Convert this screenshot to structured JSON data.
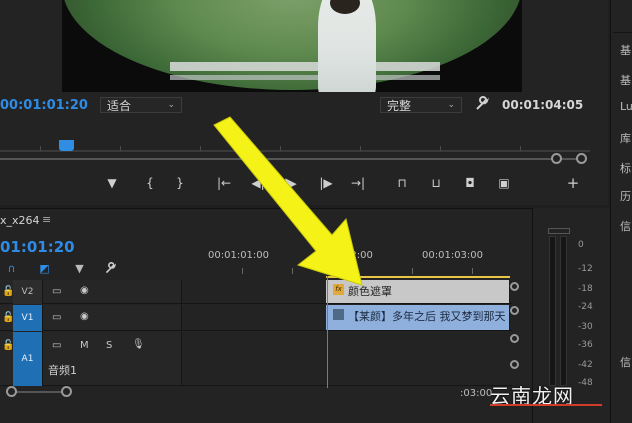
{
  "monitor": {
    "current_timecode": "00:01:01:20",
    "zoom_select": "适合",
    "quality_select": "完整",
    "duration_timecode": "00:01:04:05"
  },
  "controls": {
    "marker": "▼",
    "in": "{",
    "out": "}",
    "go_in": "|←",
    "step_back": "◀|",
    "play": "▶",
    "step_forward": "|▶",
    "go_out": "→|",
    "lift": "⊓",
    "extract": "⊔",
    "camera": "◘",
    "compare": "▣",
    "add": "+"
  },
  "timeline": {
    "sequence_name": "x_x264",
    "menu_icon": "≡",
    "timecode": "01:01:20",
    "ruler": [
      "00:01:01:00",
      "00:01:02:00",
      "00:01:03:00"
    ],
    "ruler_partial": "02:00",
    "end_timecode": ":03:00",
    "tracks": [
      {
        "target": "V2",
        "label": "",
        "clip": {
          "kind": "adjustment",
          "text": "颜色遮罩"
        }
      },
      {
        "target": "V1",
        "label": "",
        "clip": {
          "kind": "video",
          "text": "【某颜】多年之后 我又梦到那天"
        }
      },
      {
        "target": "A1",
        "label": "音频1",
        "buttons": [
          "M",
          "S"
        ]
      }
    ]
  },
  "meter": {
    "labels": [
      "0",
      "-12",
      "-18",
      "-24",
      "-30",
      "-36",
      "-42",
      "-48"
    ]
  },
  "right_panel": {
    "items": [
      "基",
      "基",
      "Lu",
      "库",
      "标",
      "历",
      "信",
      "信"
    ]
  },
  "watermark": "云南龙网",
  "colors": {
    "accent_blue": "#2e8ce6",
    "arrow_yellow": "#f5f218",
    "adjustment_clip": "#c8c8c8",
    "video_clip": "#8fb0dc"
  }
}
